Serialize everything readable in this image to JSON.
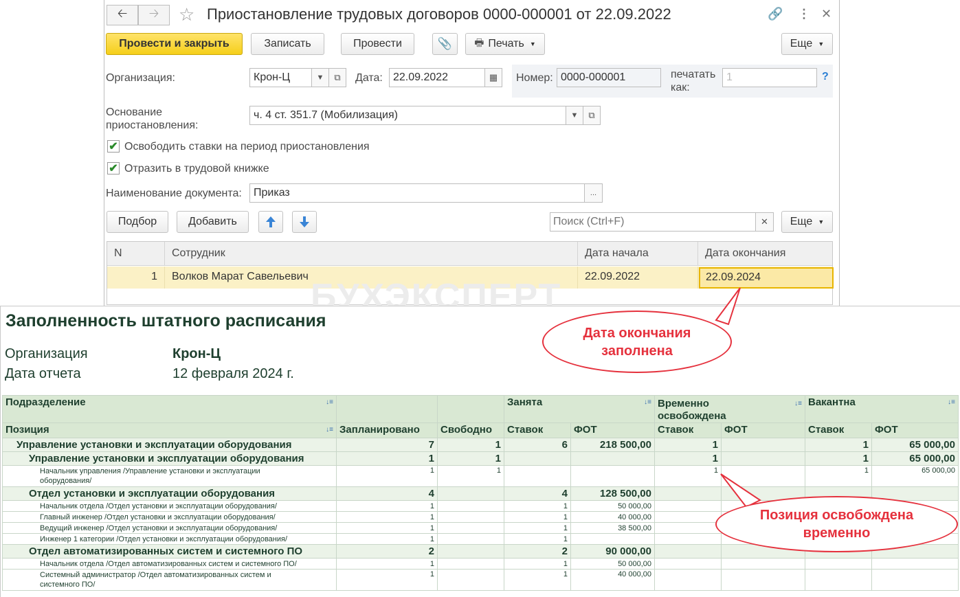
{
  "window": {
    "title": "Приостановление трудовых договоров 0000-000001 от 22.09.2022",
    "toolbar": {
      "post_close": "Провести и закрыть",
      "save": "Записать",
      "post": "Провести",
      "print": "Печать",
      "more": "Еще"
    },
    "form": {
      "org_label": "Организация:",
      "org_value": "Крон-Ц",
      "date_label": "Дата:",
      "date_value": "22.09.2022",
      "number_label": "Номер:",
      "number_value": "0000-000001",
      "print_as_label_1": "печатать",
      "print_as_label_2": "как:",
      "print_as_value": "1",
      "help": "?",
      "basis_label_1": "Основание",
      "basis_label_2": "приостановления:",
      "basis_value": "ч. 4 ст. 351.7 (Мобилизация)",
      "check1_label": "Освободить ставки на период приостановления",
      "check2_label": "Отразить в трудовой книжке",
      "docname_label": "Наименование документа:",
      "docname_value": "Приказ",
      "ellipsis": "..."
    },
    "table_toolbar": {
      "pick": "Подбор",
      "add": "Добавить",
      "search_placeholder": "Поиск (Ctrl+F)",
      "more": "Еще"
    },
    "table": {
      "headers": [
        "N",
        "Сотрудник",
        "Дата начала",
        "Дата окончания"
      ],
      "rows": [
        {
          "n": "1",
          "employee": "Волков Марат Савельевич",
          "start": "22.09.2022",
          "end": "22.09.2024"
        }
      ]
    }
  },
  "watermark": "БУХЭКСПЕРТ",
  "report": {
    "title": "Заполненность штатного расписания",
    "org_label": "Организация",
    "org_value": "Крон-Ц",
    "date_label": "Дата отчета",
    "date_value": "12 февраля 2024 г.",
    "header1": {
      "dept": "Подразделение",
      "occupied": "Занята",
      "temp_1": "Временно",
      "temp_2": "освобождена",
      "vacant": "Вакантна"
    },
    "header2": [
      "Позиция",
      "Запланировано",
      "Свободно",
      "Ставок",
      "ФОТ",
      "Ставок",
      "ФОТ",
      "Ставок",
      "ФОТ"
    ],
    "rows": [
      {
        "kind": "grp0",
        "cells": [
          "Управление установки и эксплуатации оборудования",
          "7",
          "1",
          "6",
          "218 500,00",
          "1",
          "",
          "1",
          "65 000,00"
        ]
      },
      {
        "kind": "grp1",
        "cells": [
          "Управление установки и эксплуатации оборудования",
          "1",
          "1",
          "",
          "",
          "1",
          "",
          "1",
          "65 000,00"
        ]
      },
      {
        "kind": "pos",
        "cells": [
          "Начальник управления /Управление установки и эксплуатации",
          "1",
          "1",
          "",
          "",
          "1",
          "",
          "1",
          "65 000,00"
        ],
        "line2": "оборудования/"
      },
      {
        "kind": "grp1",
        "cells": [
          "Отдел установки и эксплуатации оборудования",
          "4",
          "",
          "4",
          "128 500,00",
          "",
          "",
          "",
          ""
        ]
      },
      {
        "kind": "pos",
        "cells": [
          "Начальник отдела /Отдел установки и эксплуатации оборудования/",
          "1",
          "",
          "1",
          "50 000,00",
          "",
          "",
          "",
          ""
        ]
      },
      {
        "kind": "pos",
        "cells": [
          "Главный инженер /Отдел установки и эксплуатации оборудования/",
          "1",
          "",
          "1",
          "40 000,00",
          "",
          "",
          "",
          ""
        ]
      },
      {
        "kind": "pos",
        "cells": [
          "Ведущий инженер /Отдел установки и эксплуатации оборудования/",
          "1",
          "",
          "1",
          "38 500,00",
          "",
          "",
          "",
          ""
        ]
      },
      {
        "kind": "pos",
        "cells": [
          "Инженер 1 категории /Отдел установки и эксплуатации оборудования/",
          "1",
          "",
          "1",
          "",
          "",
          "",
          "",
          ""
        ]
      },
      {
        "kind": "grp1",
        "cells": [
          "Отдел автоматизированных систем и системного ПО",
          "2",
          "",
          "2",
          "90 000,00",
          "",
          "",
          "",
          ""
        ]
      },
      {
        "kind": "pos",
        "cells": [
          "Начальник отдела /Отдел автоматизированных систем и системного ПО/",
          "1",
          "",
          "1",
          "50 000,00",
          "",
          "",
          "",
          ""
        ]
      },
      {
        "kind": "pos",
        "cells": [
          "Системный администратор /Отдел автоматизированных систем и",
          "1",
          "",
          "1",
          "40 000,00",
          "",
          "",
          "",
          ""
        ],
        "line2": "системного ПО/"
      }
    ]
  },
  "callouts": {
    "end_date": "Дата окончания заполнена",
    "position": "Позиция освобождена временно"
  },
  "colors": {
    "accent_yellow": "#f5cf1a",
    "callout_red": "#e5313d",
    "report_header": "#d9e8d3",
    "report_text": "#1e3f2e"
  }
}
